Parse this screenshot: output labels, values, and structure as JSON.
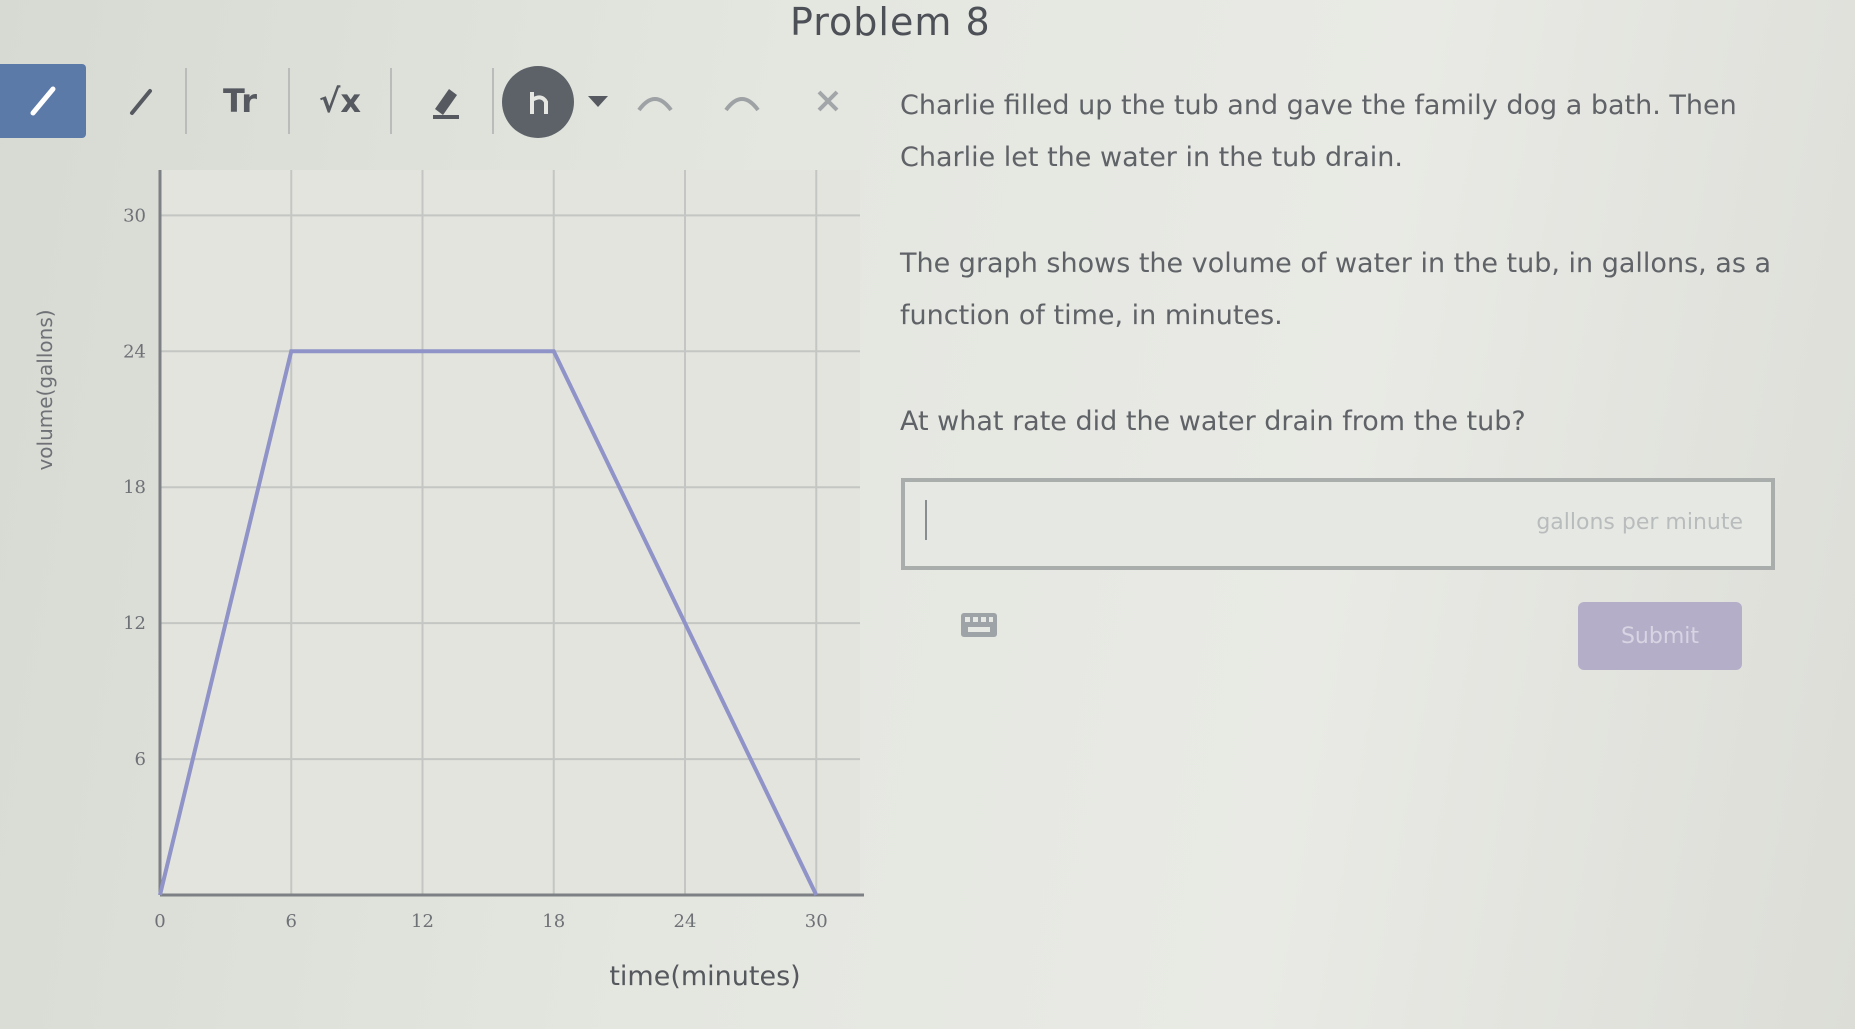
{
  "page": {
    "title": "Problem 8"
  },
  "toolbar": {
    "tools": [
      {
        "name": "pencil-icon"
      },
      {
        "name": "pen-icon"
      },
      {
        "name": "text-tool",
        "label": "Tr"
      },
      {
        "name": "math-tool",
        "label": "√x"
      },
      {
        "name": "eraser-icon"
      },
      {
        "name": "undo-redo-icon"
      }
    ]
  },
  "problem": {
    "line1": "Charlie filled up the tub and gave the family dog a bath. Then",
    "line2": "Charlie let the water in the tub drain.",
    "line3": "The graph shows the volume of water in the tub, in gallons, as a",
    "line4": "function of time, in minutes.",
    "question": "At what rate did the water drain from the tub?"
  },
  "answer": {
    "value": "",
    "unit": "gallons per minute"
  },
  "submit": {
    "label": "Submit"
  },
  "chart_data": {
    "type": "line",
    "x": [
      0,
      6,
      18,
      30
    ],
    "series": [
      {
        "values": [
          0,
          24,
          24,
          0
        ]
      }
    ],
    "xlabel": "time(minutes)",
    "ylabel": "volume(gallons)",
    "xticks": [
      0,
      6,
      12,
      18,
      24,
      30
    ],
    "yticks": [
      6,
      12,
      18,
      24,
      30
    ],
    "xtick_labels": [
      "0",
      "6",
      "12",
      "18",
      "24",
      "30"
    ],
    "ytick_labels": [
      "6",
      "12",
      "18",
      "24",
      "30"
    ],
    "xlim": [
      0,
      32
    ],
    "ylim": [
      0,
      32
    ],
    "grid": true,
    "line_color": "#8f93c7"
  },
  "colors": {
    "accent": "#5b7aa8",
    "submit": "#b5aec9"
  }
}
